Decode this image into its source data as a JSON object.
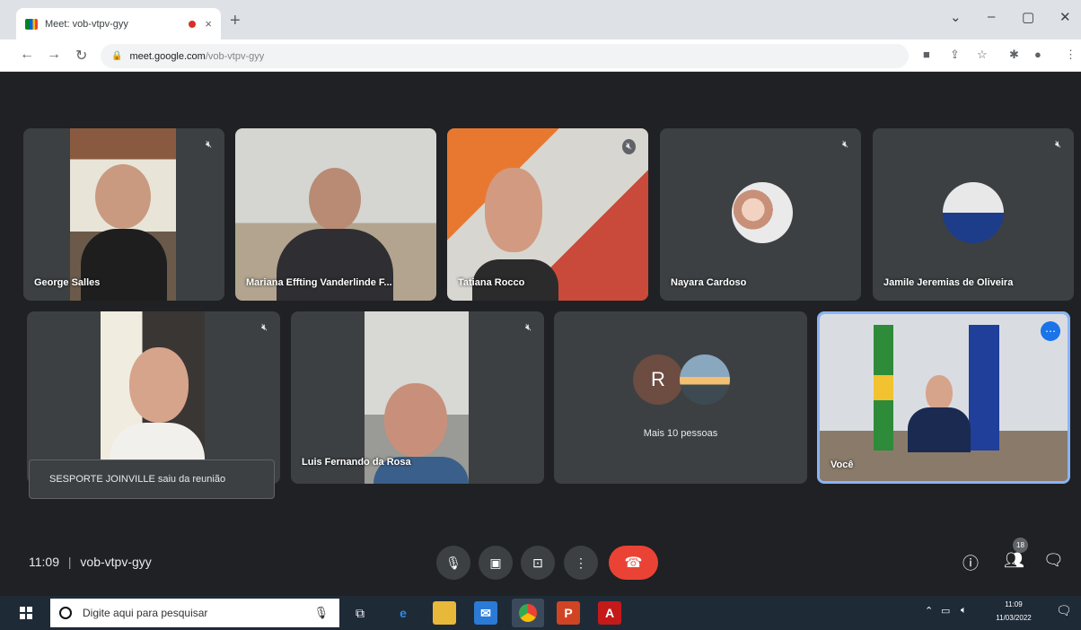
{
  "browser": {
    "tab_title": "Meet: vob-vtpv-gyy",
    "tab_close": "×",
    "new_tab": "+",
    "url_domain": "meet.google.com",
    "url_path": "/vob-vtpv-gyy",
    "window_controls": {
      "chevron": "⌄",
      "minimize": "–",
      "maximize": "▢",
      "close": "✕"
    }
  },
  "participants": [
    {
      "name": "George Salles",
      "muted": true
    },
    {
      "name": "Mariana Effting Vanderlinde F...",
      "muted": true
    },
    {
      "name": "Tatiana Rocco",
      "muted": true
    },
    {
      "name": "Nayara Cardoso",
      "muted": true
    },
    {
      "name": "Jamile Jeremias de Oliveira",
      "muted": true
    },
    {
      "name": "",
      "muted": true
    },
    {
      "name": "Luis Fernando da Rosa",
      "muted": true
    },
    {
      "name": "Você",
      "muted": false
    }
  ],
  "more_tile": {
    "avatar_letter": "R",
    "label": "Mais 10 pessoas"
  },
  "notification": "SESPORTE JOINVILLE saiu da reunião",
  "meeting_info": {
    "time": "11:09",
    "separator": "|",
    "code": "vob-vtpv-gyy"
  },
  "people_count": "18",
  "colors": {
    "end_call": "#ea4335",
    "tile_bg": "#3c4043",
    "meet_bg": "#202124",
    "self_border": "#8ab4f8",
    "accent": "#1a73e8"
  },
  "taskbar": {
    "search_placeholder": "Digite aqui para pesquisar",
    "time": "11:09",
    "date": "11/03/2022"
  },
  "icons": [
    "mic-off-icon",
    "mic-icon",
    "camera-icon",
    "present-icon",
    "more-icon",
    "end-call-icon",
    "info-icon",
    "people-icon",
    "chat-icon",
    "windows-start-icon",
    "edge-icon",
    "explorer-icon",
    "mail-icon",
    "chrome-icon",
    "powerpoint-icon",
    "acrobat-icon"
  ]
}
